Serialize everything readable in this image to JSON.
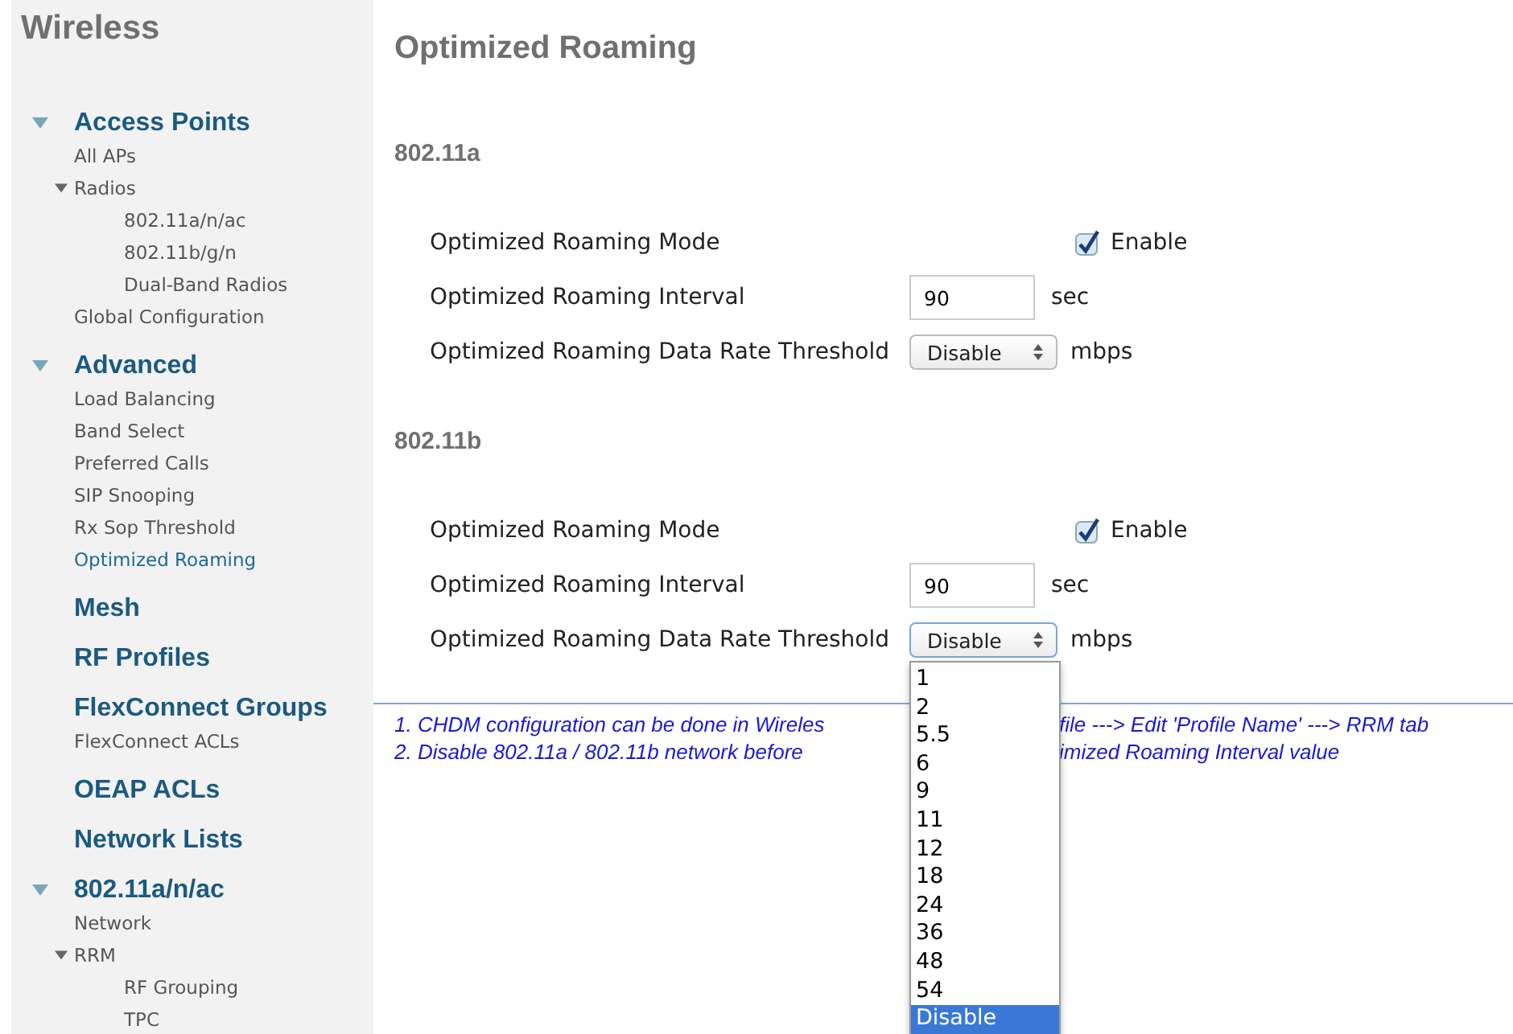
{
  "sidebar": {
    "title": "Wireless",
    "groups": [
      {
        "label": "Access Points",
        "expanded": true,
        "items": [
          {
            "label": "All APs",
            "selected": false
          },
          {
            "label": "Radios",
            "selected": false,
            "expanded": true,
            "children": [
              {
                "label": "802.11a/n/ac",
                "selected": false
              },
              {
                "label": "802.11b/g/n",
                "selected": false
              },
              {
                "label": "Dual-Band Radios",
                "selected": false
              }
            ]
          },
          {
            "label": "Global Configuration",
            "selected": false
          }
        ]
      },
      {
        "label": "Advanced",
        "expanded": true,
        "items": [
          {
            "label": "Load Balancing",
            "selected": false
          },
          {
            "label": "Band Select",
            "selected": false
          },
          {
            "label": "Preferred Calls",
            "selected": false
          },
          {
            "label": "SIP Snooping",
            "selected": false
          },
          {
            "label": "Rx Sop Threshold",
            "selected": false
          },
          {
            "label": "Optimized Roaming",
            "selected": true
          }
        ]
      },
      {
        "label": "Mesh"
      },
      {
        "label": "RF Profiles"
      },
      {
        "label": "FlexConnect Groups",
        "items": [
          {
            "label": "FlexConnect ACLs",
            "selected": false
          }
        ]
      },
      {
        "label": "OEAP ACLs"
      },
      {
        "label": "Network Lists"
      },
      {
        "label": "802.11a/n/ac",
        "expanded": true,
        "items": [
          {
            "label": "Network",
            "selected": false
          },
          {
            "label": "RRM",
            "selected": false,
            "expanded": true,
            "children": [
              {
                "label": "RF Grouping",
                "selected": false
              },
              {
                "label": "TPC",
                "selected": false
              }
            ]
          }
        ]
      }
    ]
  },
  "page": {
    "title": "Optimized Roaming",
    "bands": [
      {
        "title": "802.11a",
        "mode_label": "Optimized Roaming Mode",
        "mode_enabled": true,
        "enable_label": "Enable",
        "interval_label": "Optimized Roaming Interval",
        "interval": "90",
        "interval_unit": "sec",
        "threshold_label": "Optimized Roaming Data Rate Threshold",
        "threshold": "Disable",
        "threshold_unit": "mbps",
        "dropdown_open": false
      },
      {
        "title": "802.11b",
        "mode_label": "Optimized Roaming Mode",
        "mode_enabled": true,
        "enable_label": "Enable",
        "interval_label": "Optimized Roaming Interval",
        "interval": "90",
        "interval_unit": "sec",
        "threshold_label": "Optimized Roaming Data Rate Threshold",
        "threshold": "Disable",
        "threshold_unit": "mbps",
        "dropdown_open": true
      }
    ],
    "dropdown_options": [
      {
        "label": "1",
        "selected": false
      },
      {
        "label": "2",
        "selected": false
      },
      {
        "label": "5.5",
        "selected": false
      },
      {
        "label": "6",
        "selected": false
      },
      {
        "label": "9",
        "selected": false
      },
      {
        "label": "11",
        "selected": false
      },
      {
        "label": "12",
        "selected": false
      },
      {
        "label": "18",
        "selected": false
      },
      {
        "label": "24",
        "selected": false
      },
      {
        "label": "36",
        "selected": false
      },
      {
        "label": "48",
        "selected": false
      },
      {
        "label": "54",
        "selected": false
      },
      {
        "label": "Disable",
        "selected": true
      }
    ],
    "notes": [
      {
        "left": "1. CHDM configuration can be done in Wireles",
        "right": "file ---> Edit 'Profile Name' ---> RRM tab"
      },
      {
        "left": "2. Disable 802.11a / 802.11b network before",
        "right": "imized Roaming Interval value"
      }
    ]
  }
}
